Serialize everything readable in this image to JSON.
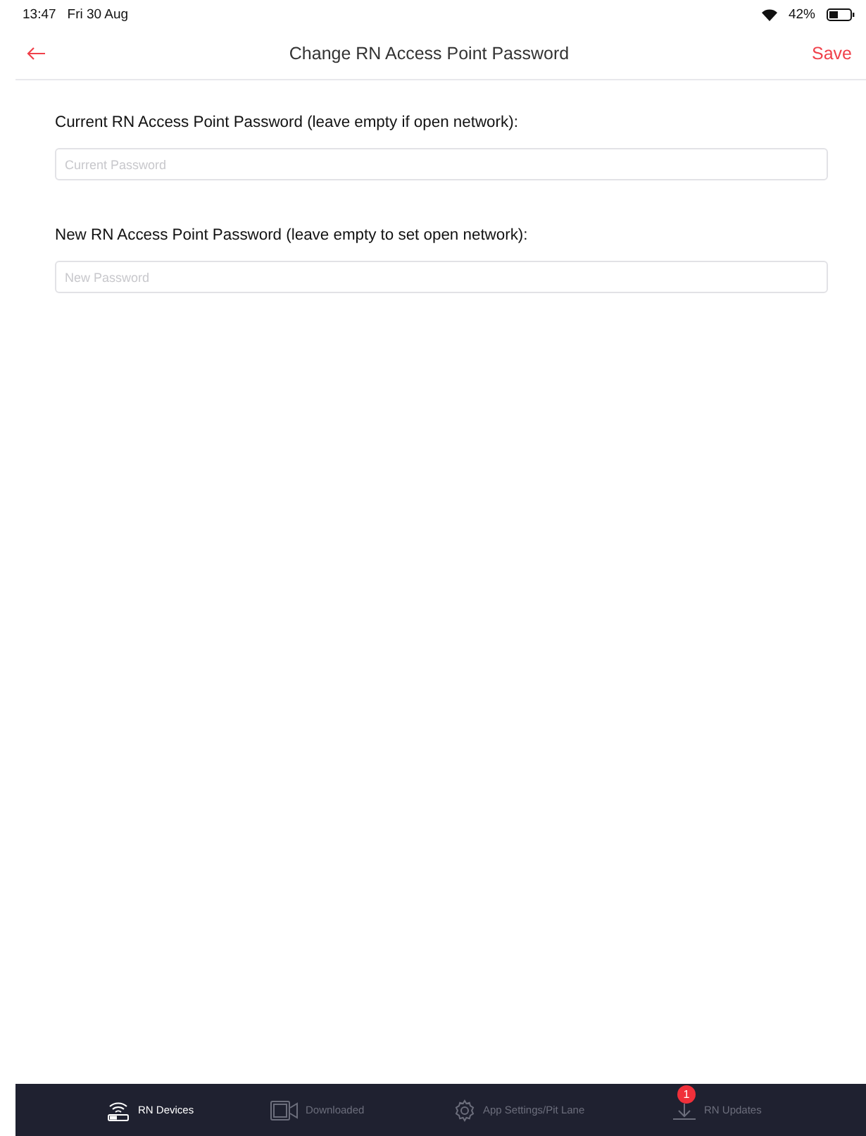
{
  "status_bar": {
    "time": "13:47",
    "date": "Fri 30 Aug",
    "battery": "42%"
  },
  "nav": {
    "title": "Change RN Access Point Password",
    "action": "Save"
  },
  "fields": [
    {
      "label": "Current RN Access Point Password (leave empty if open network):",
      "placeholder": "Current Password"
    },
    {
      "label": "New RN Access Point Password (leave empty to set open network):",
      "placeholder": "New Password"
    }
  ],
  "tab_bar": [
    {
      "kind": "devices",
      "label": "RN Devices",
      "selected": true
    },
    {
      "kind": "downloaded",
      "label": "Downloaded",
      "selected": false
    },
    {
      "kind": "settings",
      "label": "App Settings/Pit Lane",
      "selected": false
    },
    {
      "kind": "updates",
      "label": "RN Updates",
      "selected": false,
      "badge": "1"
    }
  ]
}
